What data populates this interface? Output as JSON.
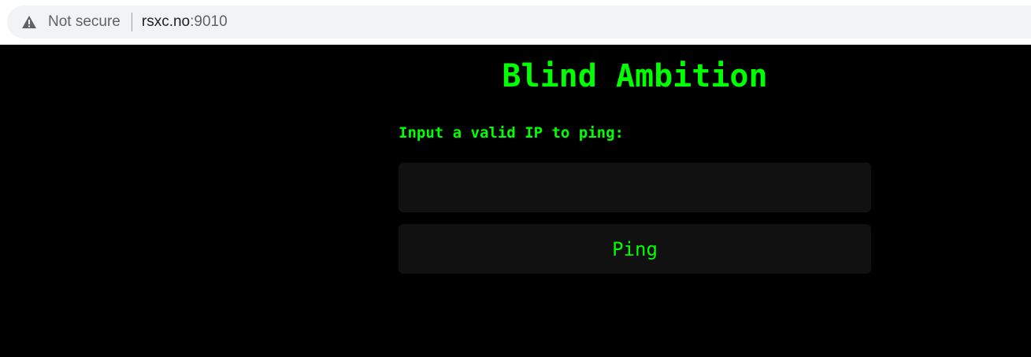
{
  "browser": {
    "security_text": "Not secure",
    "url_host": "rsxc.no",
    "url_port": ":9010",
    "security_icon": "warning-triangle-icon"
  },
  "page": {
    "title": "Blind Ambition",
    "prompt_label": "Input a valid IP to ping:",
    "ip_input_value": "",
    "ping_button_label": "Ping"
  },
  "colors": {
    "background": "#000000",
    "accent_green": "#00ff00",
    "field_background": "#111111"
  }
}
